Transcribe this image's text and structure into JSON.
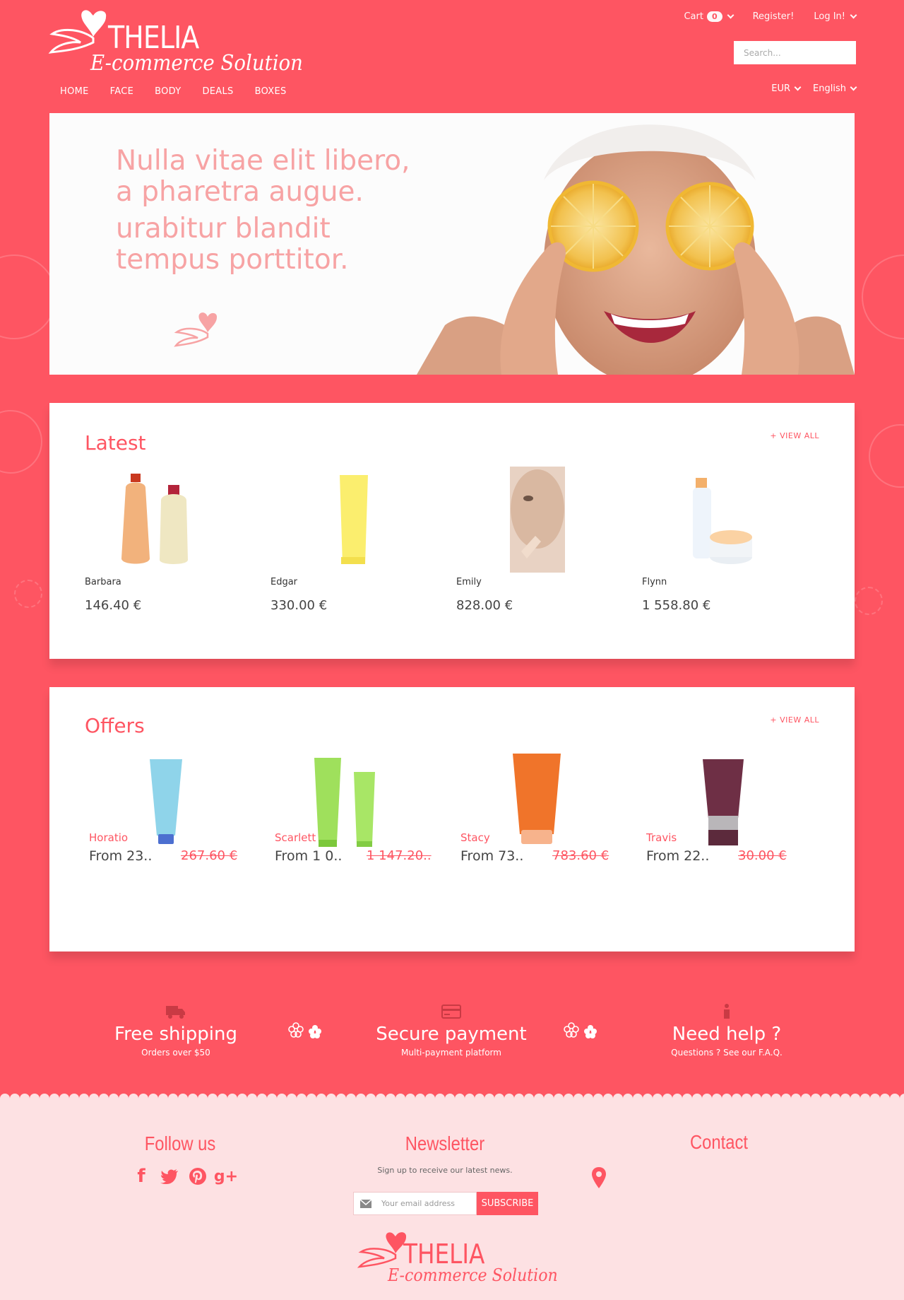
{
  "brand": {
    "name": "THELIA",
    "tagline": "E-commerce Solution"
  },
  "top_links": {
    "cart_label": "Cart",
    "cart_count": "0",
    "register": "Register!",
    "login": "Log In!"
  },
  "search": {
    "placeholder": "Search..."
  },
  "nav": [
    "HOME",
    "FACE",
    "BODY",
    "DEALS",
    "BOXES"
  ],
  "locale": {
    "currency": "EUR",
    "language": "English"
  },
  "hero": {
    "line1": "Nulla vitae elit libero,",
    "line2": "a pharetra augue.",
    "line3": "urabitur blandit",
    "line4": "tempus porttitor."
  },
  "latest": {
    "title": "Latest",
    "view_all": "+ VIEW ALL",
    "products": [
      {
        "name": "Barbara",
        "price": "146.40 €"
      },
      {
        "name": "Edgar",
        "price": "330.00 €"
      },
      {
        "name": "Emily",
        "price": "828.00 €"
      },
      {
        "name": "Flynn",
        "price": "1 558.80 €"
      }
    ]
  },
  "offers": {
    "title": "Offers",
    "view_all": "+ VIEW ALL",
    "products": [
      {
        "name": "Horatio",
        "price": "From 23..",
        "old_price": "267.60 €"
      },
      {
        "name": "Scarlett",
        "price": "From 1 0..",
        "old_price": "1 147.20.."
      },
      {
        "name": "Stacy",
        "price": "From 73..",
        "old_price": "783.60 €"
      },
      {
        "name": "Travis",
        "price": "From 22..",
        "old_price": "30.00 €"
      }
    ]
  },
  "features": [
    {
      "icon": "truck-icon",
      "title": "Free shipping",
      "sub": "Orders over $50"
    },
    {
      "icon": "credit-card-icon",
      "title": "Secure payment",
      "sub": "Multi-payment platform"
    },
    {
      "icon": "info-icon",
      "title": "Need help ?",
      "sub": "Questions ? See our F.A.Q."
    }
  ],
  "footer": {
    "follow_title": "Follow us",
    "newsletter_title": "Newsletter",
    "newsletter_sub": "Sign up to receive our latest news.",
    "email_placeholder": "Your email address",
    "subscribe": "SUBSCRIBE",
    "contact_title": "Contact",
    "socials": [
      "facebook-icon",
      "twitter-icon",
      "pinterest-icon",
      "google-plus-icon"
    ]
  },
  "colors": {
    "accent": "#fe5562",
    "footer_bg": "#fde1e3",
    "hero_text": "#f7a3a4"
  }
}
